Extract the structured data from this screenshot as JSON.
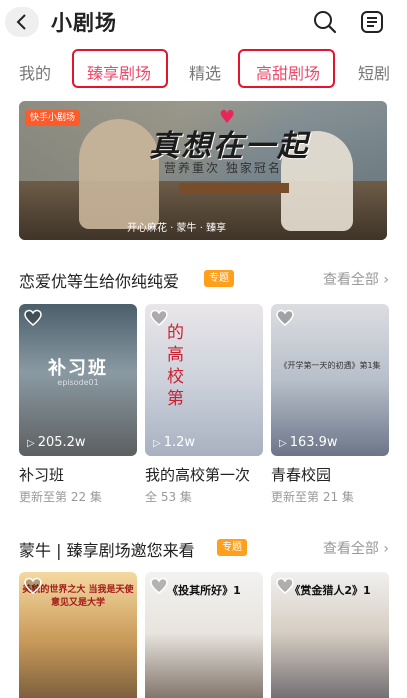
{
  "header": {
    "title": "小剧场",
    "back_icon": "chevron-left-icon",
    "search_icon": "search-icon",
    "menu_icon": "list-menu-icon"
  },
  "tabs": [
    {
      "label": "我的",
      "highlighted": false,
      "boxed": false
    },
    {
      "label": "臻享剧场",
      "highlighted": true,
      "boxed": true
    },
    {
      "label": "精选",
      "highlighted": false,
      "boxed": false
    },
    {
      "label": "高甜剧场",
      "highlighted": true,
      "boxed": true
    },
    {
      "label": "短剧",
      "highlighted": false,
      "boxed": false
    }
  ],
  "colors": {
    "tab_highlight": "#ee4a6a",
    "tab_box": "#e3142e",
    "badge": "#ff9f1c"
  },
  "banner": {
    "logo": "快手小剧场",
    "title": "真想在一起",
    "subtitle": "营养重次 独家冠名",
    "sponsors": "开心麻花 · 蒙牛 · 臻享"
  },
  "sections": [
    {
      "title": "恋爱优等生给你纯纯爱",
      "badge": "专题",
      "see_all": "查看全部 ›",
      "cards": [
        {
          "title": "补习班",
          "sub": "更新至第 22 集",
          "views": "205.2w",
          "overlay": "补习班",
          "overlay2": "episode01"
        },
        {
          "title": "我的高校第一次",
          "sub": "全 53 集",
          "views": "1.2w",
          "overlay": "的高校第"
        },
        {
          "title": "青春校园",
          "sub": "更新至第 21 集",
          "views": "163.9w",
          "overlay": "《开学第一天的初遇》第1集"
        }
      ]
    },
    {
      "title": "蒙牛 | 臻享剧场邀您来看",
      "badge": "专题",
      "see_all": "查看全部 ›",
      "cards": [
        {
          "overlay": "美貌的世界之大 当我是天使 意见又是大学"
        },
        {
          "overlay": "《投其所好》1"
        },
        {
          "overlay": "《赏金猎人2》1"
        }
      ]
    }
  ]
}
